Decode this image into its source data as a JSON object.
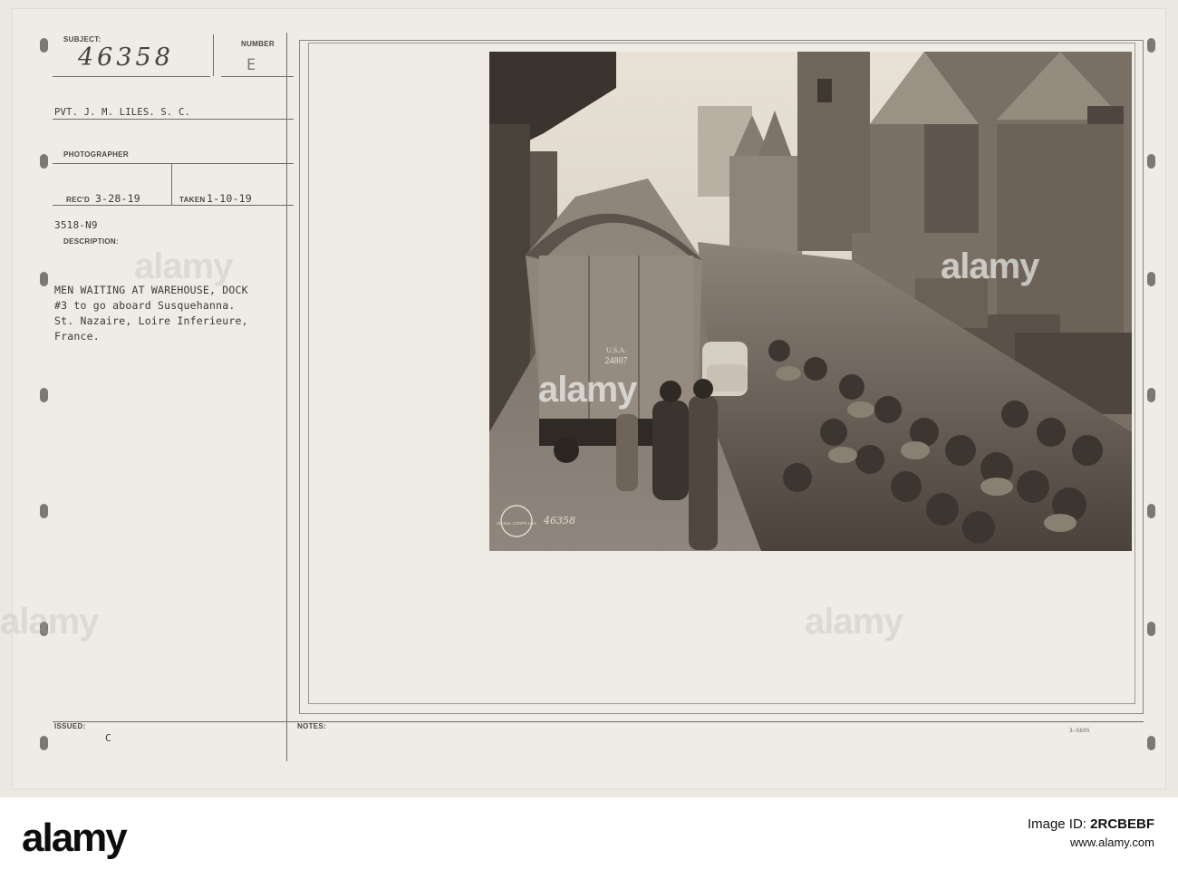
{
  "card": {
    "subject_label": "SUBJECT:",
    "subject_number": "46358",
    "number_label": "NUMBER",
    "number_value": "E",
    "photographer_name": "PVT. J. M. LILES. S. C.",
    "photographer_label": "PHOTOGRAPHER",
    "recd_label": "REC'D",
    "recd_date": "3-28-19",
    "taken_label": "TAKEN",
    "taken_date": "1-10-19",
    "file_code": "3518-N9",
    "description_label": "DESCRIPTION:",
    "description_lines": [
      "MEN WAITING AT WAREHOUSE, DOCK",
      "#3 to go aboard Susquehanna.",
      "St. Nazaire, Loire Inferieure,",
      "France."
    ],
    "issued_label": "ISSUED:",
    "issued_value": "C",
    "notes_label": "NOTES:",
    "form_number": "3—5605"
  },
  "photo": {
    "railcar_marking_line1": "U.S.A.",
    "railcar_marking_line2": "24807",
    "negative_number": "46358",
    "stamp_text": "SIGNAL CORPS USA"
  },
  "watermark": {
    "text": "alamy"
  },
  "footer": {
    "logo": "alamy",
    "image_id_label": "Image ID:",
    "image_id": "2RCBEBF",
    "url": "www.alamy.com"
  }
}
